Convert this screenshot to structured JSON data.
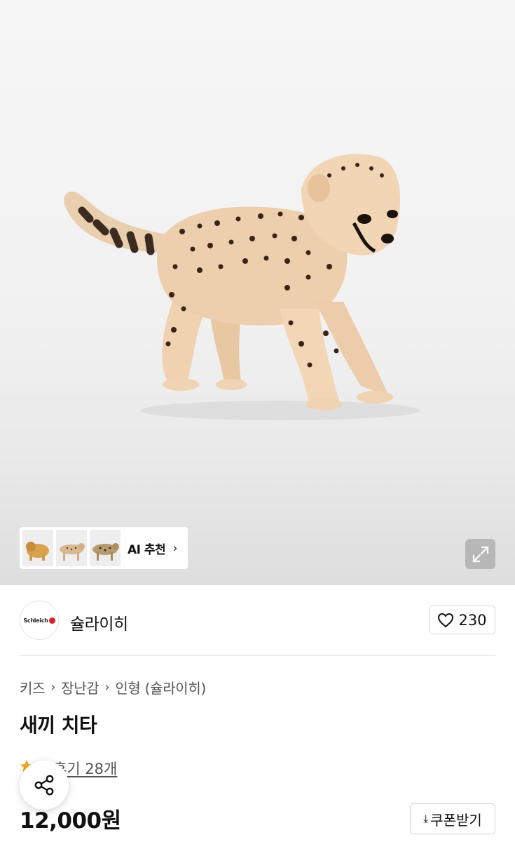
{
  "gallery": {
    "image_alt_icon": "cheetah-cub-figure",
    "ai_recommend": {
      "label": "AI 추천",
      "thumbnails": [
        "lion-cub-figure",
        "cheetah-figure",
        "leopard-figure"
      ]
    },
    "expand_icon": "expand-icon"
  },
  "brand": {
    "logo_text": "Schleich",
    "name": "슐라이히",
    "like_count": "230"
  },
  "breadcrumb": [
    "키즈",
    "장난감",
    "인형 (슐라이히)"
  ],
  "product": {
    "title": "새끼 치타",
    "review_text": "후기 28개",
    "price": "12,000원",
    "coupon_label": "쿠폰받기"
  },
  "colors": {
    "accent_star": "#f5a623",
    "brand_logo_red": "#d2232a"
  }
}
